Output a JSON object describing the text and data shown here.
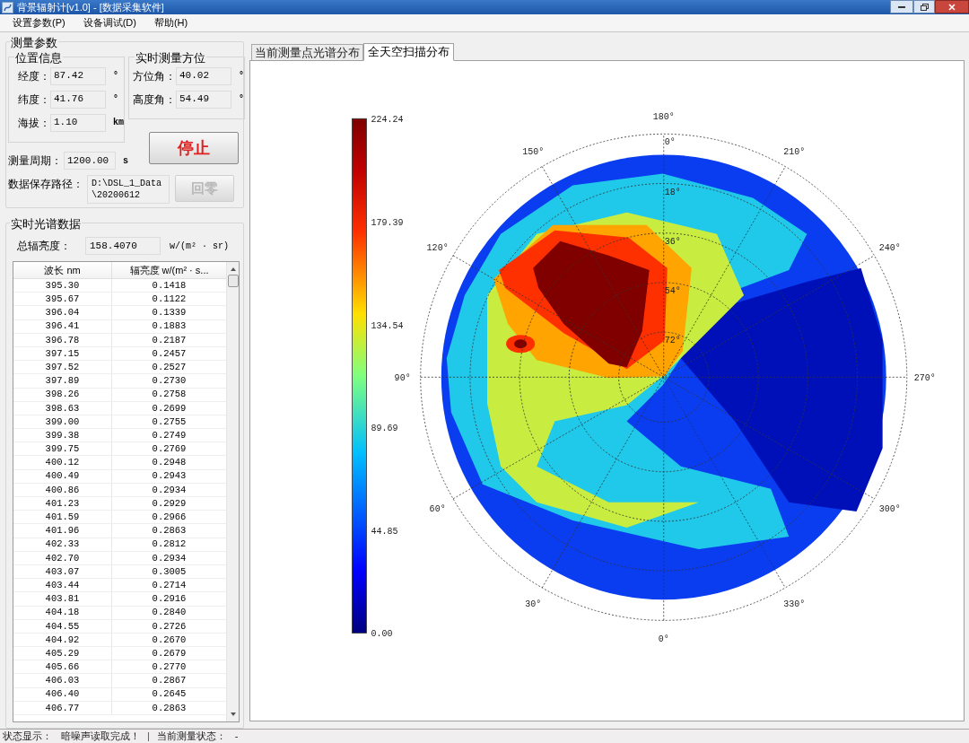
{
  "window": {
    "title": "背景辐射计[v1.0] - [数据采集软件]"
  },
  "menu": [
    {
      "label": "设置参数(P)"
    },
    {
      "label": "设备调试(D)"
    },
    {
      "label": "帮助(H)"
    }
  ],
  "measurement_params": {
    "title": "测量参数",
    "location": {
      "title": "位置信息",
      "fields": [
        {
          "label": "经度：",
          "value": "87.42",
          "unit": "°"
        },
        {
          "label": "纬度：",
          "value": "41.76",
          "unit": "°"
        },
        {
          "label": "海拔：",
          "value": "1.10",
          "unit": "km"
        }
      ]
    },
    "orientation": {
      "title": "实时测量方位",
      "fields": [
        {
          "label": "方位角：",
          "value": "40.02",
          "unit": "°"
        },
        {
          "label": "高度角：",
          "value": "54.49",
          "unit": "°"
        }
      ]
    },
    "period": {
      "label": "测量周期：",
      "value": "1200.00",
      "unit": "s"
    },
    "save_path": {
      "label": "数据保存路径：",
      "value": "D:\\DSL_1_Data\\20200612"
    },
    "buttons": [
      {
        "label": "停止",
        "disabled": false
      },
      {
        "label": "回零",
        "disabled": true
      }
    ]
  },
  "spectrum": {
    "title": "实时光谱数据",
    "total": {
      "label": "总辐亮度：",
      "value": "158.4070",
      "unit": "w/(m² · sr)"
    },
    "table": {
      "columns": [
        "波长 nm",
        "辐亮度  w/(m² · s..."
      ],
      "rows": [
        [
          "395.30",
          "0.1418"
        ],
        [
          "395.67",
          "0.1122"
        ],
        [
          "396.04",
          "0.1339"
        ],
        [
          "396.41",
          "0.1883"
        ],
        [
          "396.78",
          "0.2187"
        ],
        [
          "397.15",
          "0.2457"
        ],
        [
          "397.52",
          "0.2527"
        ],
        [
          "397.89",
          "0.2730"
        ],
        [
          "398.26",
          "0.2758"
        ],
        [
          "398.63",
          "0.2699"
        ],
        [
          "399.00",
          "0.2755"
        ],
        [
          "399.38",
          "0.2749"
        ],
        [
          "399.75",
          "0.2769"
        ],
        [
          "400.12",
          "0.2948"
        ],
        [
          "400.49",
          "0.2943"
        ],
        [
          "400.86",
          "0.2934"
        ],
        [
          "401.23",
          "0.2929"
        ],
        [
          "401.59",
          "0.2966"
        ],
        [
          "401.96",
          "0.2863"
        ],
        [
          "402.33",
          "0.2812"
        ],
        [
          "402.70",
          "0.2934"
        ],
        [
          "403.07",
          "0.3005"
        ],
        [
          "403.44",
          "0.2714"
        ],
        [
          "403.81",
          "0.2916"
        ],
        [
          "404.18",
          "0.2840"
        ],
        [
          "404.55",
          "0.2726"
        ],
        [
          "404.92",
          "0.2670"
        ],
        [
          "405.29",
          "0.2679"
        ],
        [
          "405.66",
          "0.2770"
        ],
        [
          "406.03",
          "0.2867"
        ],
        [
          "406.40",
          "0.2645"
        ],
        [
          "406.77",
          "0.2863"
        ]
      ]
    }
  },
  "tabs": [
    {
      "label": "当前测量点光谱分布",
      "selected": false
    },
    {
      "label": "全天空扫描分布",
      "selected": true
    }
  ],
  "sky_map": {
    "colorbar_ticks": [
      "224.24",
      "179.39",
      "134.54",
      "89.69",
      "44.85",
      "0.00"
    ],
    "azimuth_labels": [
      "180°",
      "150°",
      "120°",
      "90°",
      "60°",
      "30°",
      "0°",
      "330°",
      "300°",
      "270°",
      "240°",
      "210°"
    ],
    "elevation_labels": [
      "0°",
      "18°",
      "36°",
      "54°",
      "72°"
    ]
  },
  "status_bar": [
    {
      "kind": "label",
      "text": "状态显示："
    },
    {
      "kind": "value",
      "text": "暗噪声读取完成！"
    },
    {
      "kind": "separator",
      "text": "|"
    },
    {
      "kind": "label",
      "text": "当前测量状态："
    },
    {
      "kind": "value",
      "text": "-"
    }
  ]
}
